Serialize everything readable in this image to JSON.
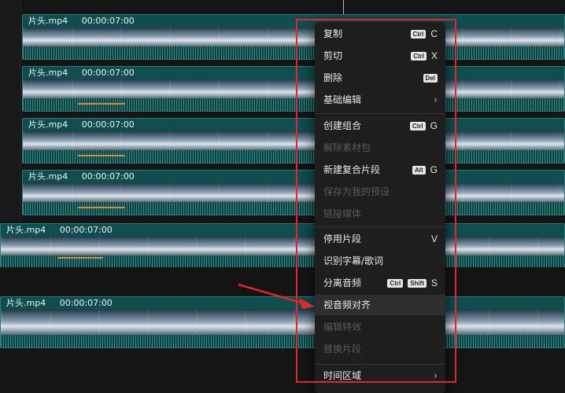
{
  "clips": [
    {
      "name": "片头.mp4",
      "duration": "00:00:07:00"
    },
    {
      "name": "片头.mp4",
      "duration": "00:00:07:00"
    },
    {
      "name": "片头.mp4",
      "duration": "00:00:07:00"
    },
    {
      "name": "片头.mp4",
      "duration": "00:00:07:00"
    },
    {
      "name": "片头.mp4",
      "duration": "00:00:07:00"
    },
    {
      "name": "片头.mp4",
      "duration": "00:00:07:00"
    }
  ],
  "menu": {
    "copy": {
      "label": "复制",
      "mod": "Ctrl",
      "key": "C"
    },
    "cut": {
      "label": "剪切",
      "mod": "Ctrl",
      "key": "X"
    },
    "delete": {
      "label": "删除",
      "key": "Del"
    },
    "basic_edit": {
      "label": "基础编辑"
    },
    "create_group": {
      "label": "创建组合",
      "mod": "Ctrl",
      "key": "G"
    },
    "ungroup": {
      "label": "解除素材包"
    },
    "new_compound": {
      "label": "新建复合片段",
      "mod": "Alt",
      "key": "G"
    },
    "save_preset": {
      "label": "保存为我的预设"
    },
    "link_media": {
      "label": "链接媒体"
    },
    "disable_clip": {
      "label": "停用片段",
      "key": "V"
    },
    "recognize_subtitles": {
      "label": "识别字幕/歌词"
    },
    "separate_audio": {
      "label": "分离音频",
      "mod1": "Ctrl",
      "mod2": "Shift",
      "key": "S"
    },
    "av_align": {
      "label": "视音频对齐"
    },
    "edit_effects": {
      "label": "编辑特效"
    },
    "replace_clip": {
      "label": "替换片段"
    },
    "time_region": {
      "label": "时间区域"
    }
  },
  "chevron": "›",
  "colors": {
    "accent_red": "#e2262a",
    "clip_teal": "#0f4d4e",
    "menu_bg": "#1e1e1e"
  }
}
